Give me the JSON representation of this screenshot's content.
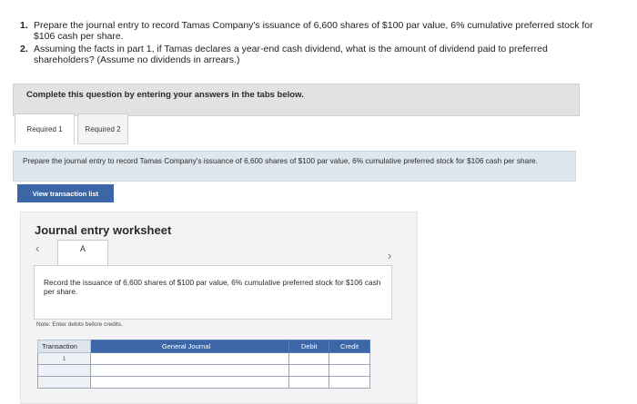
{
  "questions": [
    {
      "num": "1.",
      "text": "Prepare the journal entry to record Tamas Company's issuance of 6,600 shares of $100 par value, 6% cumulative preferred stock for $106 cash per share."
    },
    {
      "num": "2.",
      "text": "Assuming the facts in part 1, if Tamas declares a year-end cash dividend, what is the amount of dividend paid to preferred shareholders? (Assume no dividends in arrears.)"
    }
  ],
  "complete_banner": "Complete this question by entering your answers in the tabs below.",
  "tabs": [
    {
      "label": "Required 1"
    },
    {
      "label": "Required 2"
    }
  ],
  "instruction": "Prepare the journal entry to record Tamas Company's issuance of 6,600 shares of $100 par value, 6% cumulative preferred stock for $106 cash per share.",
  "view_button": "View transaction list",
  "worksheet": {
    "title": "Journal entry worksheet",
    "page_label": "A",
    "description": "Record the issuance of 6,600 shares of $100 par value, 6% cumulative preferred stock for $106 cash per share.",
    "note": "Note: Enter debits before credits.",
    "columns": [
      "Transaction",
      "General Journal",
      "Debit",
      "Credit"
    ],
    "first_transaction": "1"
  },
  "colors": {
    "accent": "#3c66a8",
    "banner": "#e2e2e2",
    "instruction_bg": "#dfe7ee"
  }
}
